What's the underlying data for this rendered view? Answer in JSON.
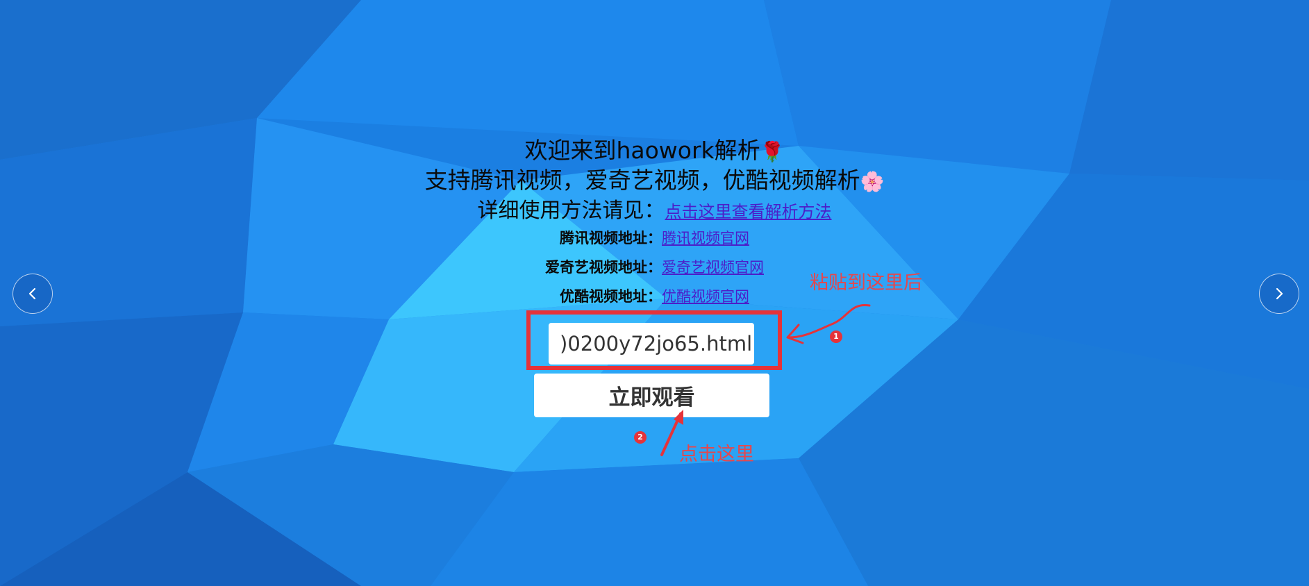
{
  "header": {
    "welcome_text": "欢迎来到haowork解析",
    "welcome_emoji": "🌹",
    "support_text": "支持腾讯视频，爱奇艺视频，优酷视频解析",
    "support_emoji": "🌸",
    "detail_label": "详细使用方法请见：",
    "detail_link": "点击这里查看解析方法"
  },
  "sites": [
    {
      "label": "腾讯视频地址：",
      "link": "腾讯视频官网"
    },
    {
      "label": "爱奇艺视频地址：",
      "link": "爱奇艺视频官网"
    },
    {
      "label": "优酷视频地址：",
      "link": "优酷视频官网"
    }
  ],
  "form": {
    "url_value": ")0200y72jo65.html",
    "watch_button": "立即观看"
  },
  "annotations": {
    "paste_hint": "粘贴到这里后",
    "click_hint": "点击这里",
    "badge_1": "1",
    "badge_2": "2"
  },
  "icons": {
    "prev": "chevron-left-icon",
    "next": "chevron-right-icon"
  },
  "colors": {
    "background": "#1b82e6",
    "annotation_red": "#e5333a",
    "link": "#4b1ec9"
  }
}
